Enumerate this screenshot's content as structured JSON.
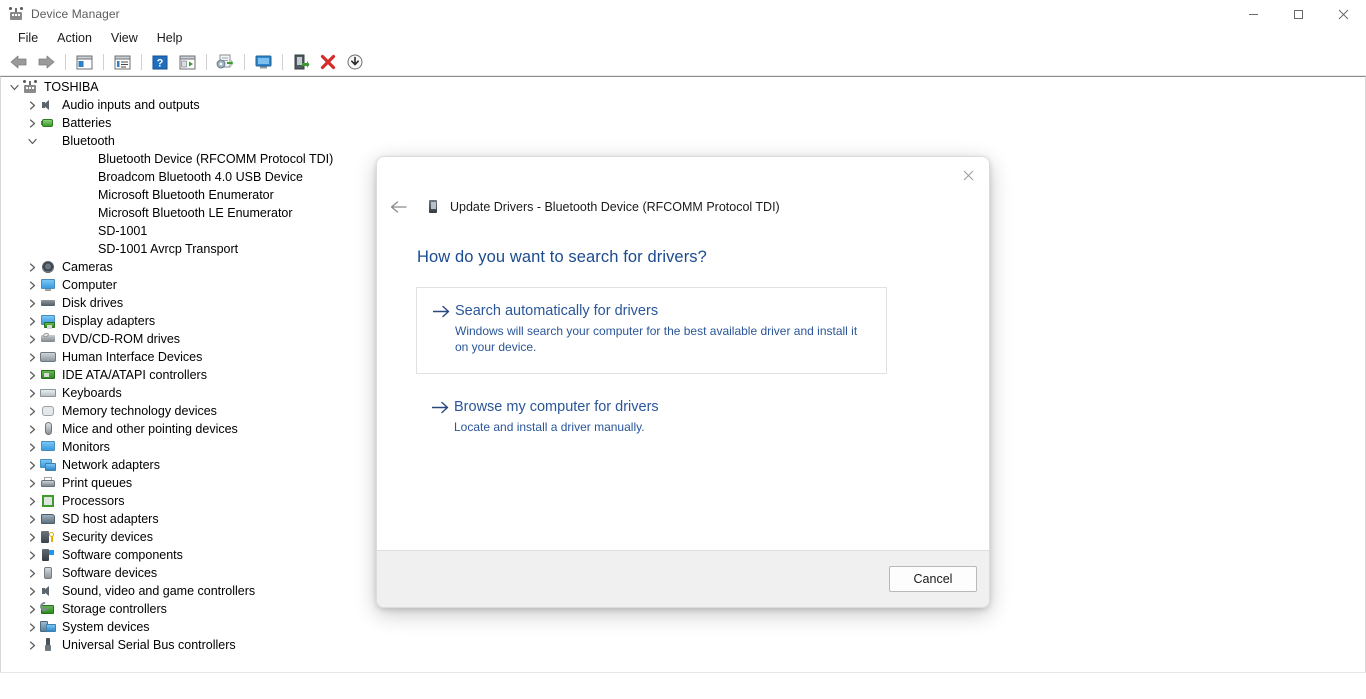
{
  "window": {
    "title": "Device Manager",
    "app_icon": "device-manager-icon",
    "controls": {
      "minimize": "minimize-icon",
      "maximize": "maximize-icon",
      "close": "close-icon"
    }
  },
  "menubar": {
    "items": [
      {
        "label": "File"
      },
      {
        "label": "Action"
      },
      {
        "label": "View"
      },
      {
        "label": "Help"
      }
    ]
  },
  "toolbar": {
    "buttons": [
      {
        "name": "back-icon"
      },
      {
        "name": "forward-icon"
      },
      {
        "name": "separator"
      },
      {
        "name": "show-hide-console-tree-icon"
      },
      {
        "name": "separator"
      },
      {
        "name": "properties-icon"
      },
      {
        "name": "separator"
      },
      {
        "name": "help-icon"
      },
      {
        "name": "scan-for-hardware-changes-icon"
      },
      {
        "name": "separator"
      },
      {
        "name": "update-driver-icon"
      },
      {
        "name": "separator"
      },
      {
        "name": "display-device-icon"
      },
      {
        "name": "separator"
      },
      {
        "name": "enable-device-icon"
      },
      {
        "name": "uninstall-device-icon"
      },
      {
        "name": "download-icon"
      }
    ]
  },
  "tree": {
    "root": {
      "label": "TOSHIBA",
      "icon": "computer-root-icon",
      "expanded": true
    },
    "items": [
      {
        "label": "Audio inputs and outputs",
        "icon": "speaker-icon",
        "level": 1,
        "expanded": false
      },
      {
        "label": "Batteries",
        "icon": "battery-icon",
        "level": 1,
        "expanded": false
      },
      {
        "label": "Bluetooth",
        "icon": "bluetooth-icon",
        "level": 1,
        "expanded": true
      },
      {
        "label": "Bluetooth Device (RFCOMM Protocol TDI)",
        "icon": "bluetooth-icon",
        "level": 2
      },
      {
        "label": "Broadcom Bluetooth 4.0 USB Device",
        "icon": "bluetooth-icon",
        "level": 2
      },
      {
        "label": "Microsoft Bluetooth Enumerator",
        "icon": "bluetooth-icon",
        "level": 2
      },
      {
        "label": "Microsoft Bluetooth LE Enumerator",
        "icon": "bluetooth-icon",
        "level": 2
      },
      {
        "label": "SD-1001",
        "icon": "bluetooth-icon",
        "level": 2
      },
      {
        "label": "SD-1001 Avrcp Transport",
        "icon": "bluetooth-icon",
        "level": 2
      },
      {
        "label": "Cameras",
        "icon": "camera-icon",
        "level": 1,
        "expanded": false
      },
      {
        "label": "Computer",
        "icon": "computer-icon",
        "level": 1,
        "expanded": false
      },
      {
        "label": "Disk drives",
        "icon": "disk-drive-icon",
        "level": 1,
        "expanded": false
      },
      {
        "label": "Display adapters",
        "icon": "display-adapter-icon",
        "level": 1,
        "expanded": false
      },
      {
        "label": "DVD/CD-ROM drives",
        "icon": "dvd-drive-icon",
        "level": 1,
        "expanded": false
      },
      {
        "label": "Human Interface Devices",
        "icon": "hid-icon",
        "level": 1,
        "expanded": false
      },
      {
        "label": "IDE ATA/ATAPI controllers",
        "icon": "ide-controller-icon",
        "level": 1,
        "expanded": false
      },
      {
        "label": "Keyboards",
        "icon": "keyboard-icon",
        "level": 1,
        "expanded": false
      },
      {
        "label": "Memory technology devices",
        "icon": "memory-icon",
        "level": 1,
        "expanded": false
      },
      {
        "label": "Mice and other pointing devices",
        "icon": "mouse-icon",
        "level": 1,
        "expanded": false
      },
      {
        "label": "Monitors",
        "icon": "monitor-icon",
        "level": 1,
        "expanded": false
      },
      {
        "label": "Network adapters",
        "icon": "network-adapter-icon",
        "level": 1,
        "expanded": false
      },
      {
        "label": "Print queues",
        "icon": "printer-icon",
        "level": 1,
        "expanded": false
      },
      {
        "label": "Processors",
        "icon": "processor-icon",
        "level": 1,
        "expanded": false
      },
      {
        "label": "SD host adapters",
        "icon": "sd-host-adapter-icon",
        "level": 1,
        "expanded": false
      },
      {
        "label": "Security devices",
        "icon": "security-device-icon",
        "level": 1,
        "expanded": false
      },
      {
        "label": "Software components",
        "icon": "software-component-icon",
        "level": 1,
        "expanded": false
      },
      {
        "label": "Software devices",
        "icon": "software-device-icon",
        "level": 1,
        "expanded": false
      },
      {
        "label": "Sound, video and game controllers",
        "icon": "sound-controller-icon",
        "level": 1,
        "expanded": false
      },
      {
        "label": "Storage controllers",
        "icon": "storage-controller-icon",
        "level": 1,
        "expanded": false
      },
      {
        "label": "System devices",
        "icon": "system-device-icon",
        "level": 1,
        "expanded": false
      },
      {
        "label": "Universal Serial Bus controllers",
        "icon": "usb-controller-icon",
        "level": 1,
        "expanded": false
      }
    ]
  },
  "dialog": {
    "title": "Update Drivers - Bluetooth Device (RFCOMM Protocol TDI)",
    "device_icon": "device-icon",
    "back_icon": "back-arrow-icon",
    "close_icon": "close-icon",
    "question": "How do you want to search for drivers?",
    "options": [
      {
        "arrow": "right-arrow-icon",
        "title": "Search automatically for drivers",
        "subtitle": "Windows will search your computer for the best available driver and install it on your device."
      },
      {
        "arrow": "right-arrow-icon",
        "title": "Browse my computer for drivers",
        "subtitle": "Locate and install a driver manually."
      }
    ],
    "cancel_label": "Cancel"
  },
  "colors": {
    "link_blue": "#2a5699",
    "heading_blue": "#1b4b8f",
    "bluetooth_blue": "#2196f3",
    "accent_red": "#d42b2b",
    "footer_gray": "#f0f0f0"
  }
}
